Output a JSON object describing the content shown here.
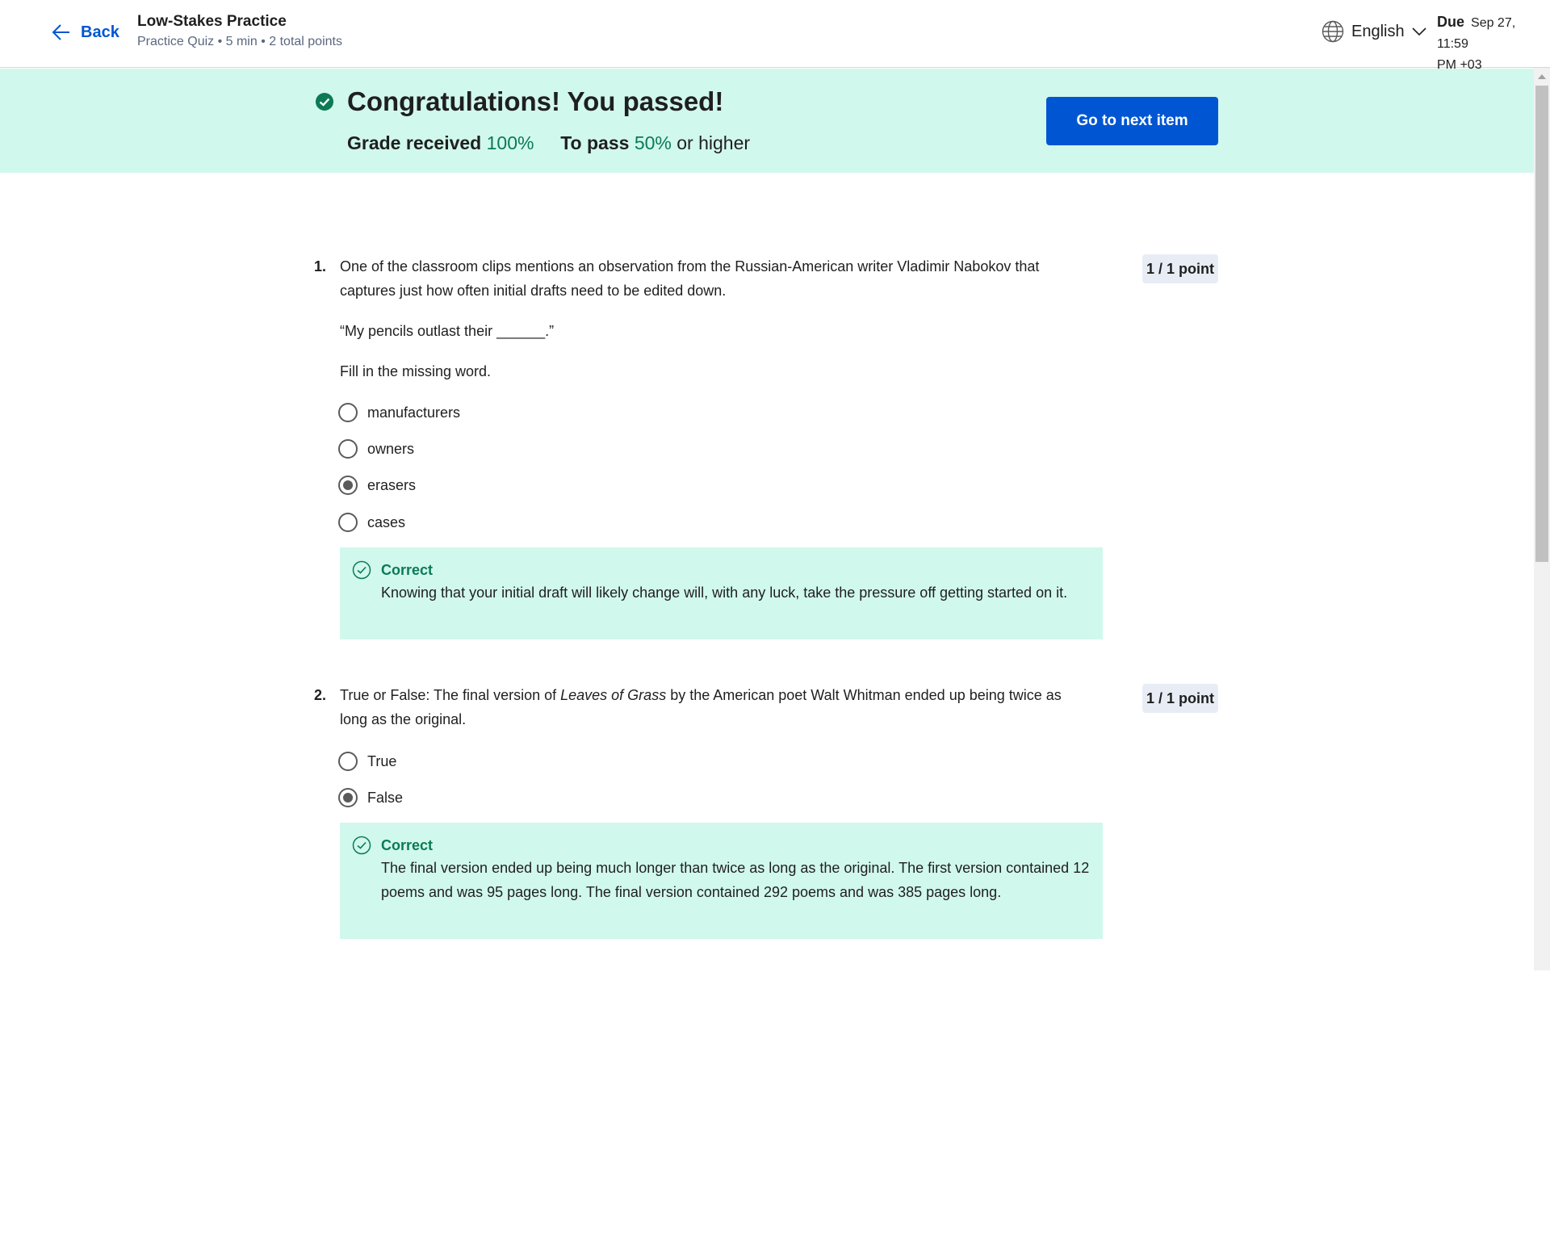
{
  "header": {
    "back_label": "Back",
    "item_title": "Low-Stakes Practice",
    "item_subtitle": "Practice Quiz • 5 min • 2 total points",
    "language": "English",
    "due_label": "Due",
    "due_date_line1": "Sep 27, 11:59",
    "due_date_line2": "PM +03"
  },
  "banner": {
    "title": "Congratulations! You passed!",
    "grade_label": "Grade received",
    "grade_value": "100%",
    "pass_label": "To pass",
    "pass_value": "50%",
    "pass_suffix": "or higher",
    "next_button": "Go to next item"
  },
  "questions": [
    {
      "number": "1.",
      "text": "One of the classroom clips mentions an observation from the Russian-American writer Vladimir Nabokov that captures just how often initial drafts need to be edited down.",
      "quote": "“My pencils outlast their ______.”",
      "instruction": "Fill in the missing word.",
      "points": "1 / 1 point",
      "options": [
        "manufacturers",
        "owners",
        "erasers",
        "cases"
      ],
      "selected": "erasers",
      "feedback_title": "Correct",
      "feedback_text": "Knowing that your initial draft will likely change will, with any luck, take the pressure off getting started on it."
    },
    {
      "number": "2.",
      "text_before": "True or False: The final version of ",
      "text_italic": "Leaves of Grass",
      "text_after": " by the American poet Walt Whitman ended up being twice as long as the original.",
      "points": "1 / 1 point",
      "options": [
        "True",
        "False"
      ],
      "selected": "False",
      "feedback_title": "Correct",
      "feedback_text": "The final version ended up being much longer than twice as long as the original. The first version contained 12 poems and was 95 pages long. The final version contained 292 poems and was 385 pages long."
    }
  ],
  "colors": {
    "accent": "#0056d2",
    "success_bg": "#d1f8ec",
    "success_text": "#0b7a55"
  }
}
